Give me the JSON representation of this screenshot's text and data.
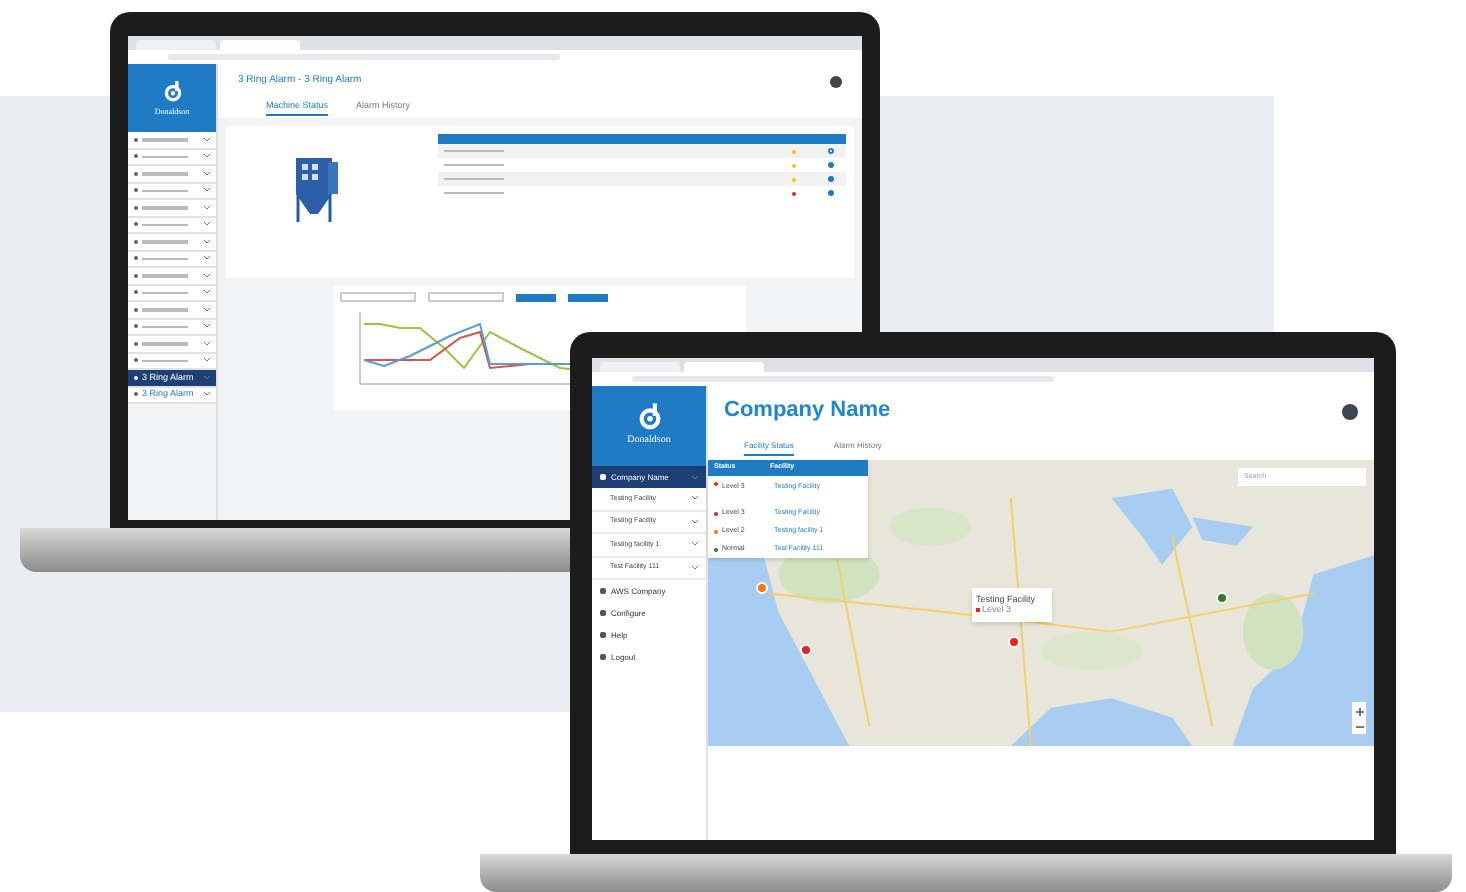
{
  "back_screen": {
    "logo": "Donaldson",
    "title": "3 Ring Alarm - 3 Ring Alarm",
    "tabs": [
      {
        "label": "Machine Status",
        "selected": true
      },
      {
        "label": "Alarm History",
        "selected": false
      }
    ],
    "sidebar_items": [
      {
        "selected": false
      },
      {
        "selected": false
      },
      {
        "selected": false
      },
      {
        "selected": false
      },
      {
        "selected": false
      },
      {
        "selected": false
      },
      {
        "selected": false
      },
      {
        "selected": false
      },
      {
        "selected": false
      },
      {
        "selected": false
      },
      {
        "selected": false
      },
      {
        "selected": false
      },
      {
        "selected": false
      },
      {
        "selected": false
      },
      {
        "label": "3 Ring Alarm",
        "selected": true
      },
      {
        "label": "3 Ring Alarm",
        "selected": false
      }
    ],
    "sensors": [
      {
        "color": "#f2c511",
        "on": false
      },
      {
        "color": "#f2c511",
        "on": true
      },
      {
        "color": "#f2c511",
        "on": true
      },
      {
        "color": "#e0261b",
        "on": true
      }
    ]
  },
  "front_screen": {
    "logo": "Donaldson",
    "company": "Company Name",
    "nav": [
      {
        "label": "Company Name",
        "selected": true,
        "children": [
          {
            "label": "Testing Facility"
          },
          {
            "label": "Testing Facility"
          },
          {
            "label": "Testing facility 1"
          },
          {
            "label": "Test Facility 111"
          }
        ]
      },
      {
        "label": "AWS Company",
        "selected": false
      },
      {
        "label": "Configure",
        "selected": false
      },
      {
        "label": "Help",
        "selected": false
      },
      {
        "label": "Logout",
        "selected": false
      }
    ],
    "tabs": [
      {
        "label": "Facility Status",
        "selected": true
      },
      {
        "label": "Alarm History",
        "selected": false
      }
    ],
    "table": {
      "columns": [
        "Status",
        "Facility"
      ],
      "rows": [
        {
          "status": "Level 3",
          "facility": "Testing Facility",
          "color": "#e0261b"
        },
        {
          "status": "Level 3",
          "facility": "Testing Facility",
          "color": "#e0261b"
        },
        {
          "status": "Level 2",
          "facility": "Testing facility 1",
          "color": "#f07a1a"
        },
        {
          "status": "Normal",
          "facility": "Test Facility 111",
          "color": "#2e7d1f"
        }
      ]
    },
    "search": {
      "placeholder": "Search"
    },
    "markers": [
      {
        "color": "#f07a1a"
      },
      {
        "color": "#e0261b"
      },
      {
        "color": "#e0261b"
      },
      {
        "color": "#2e7d1f"
      }
    ],
    "popup": {
      "title": "Testing Facility",
      "status": "Level 3",
      "color": "#e0261b"
    }
  }
}
